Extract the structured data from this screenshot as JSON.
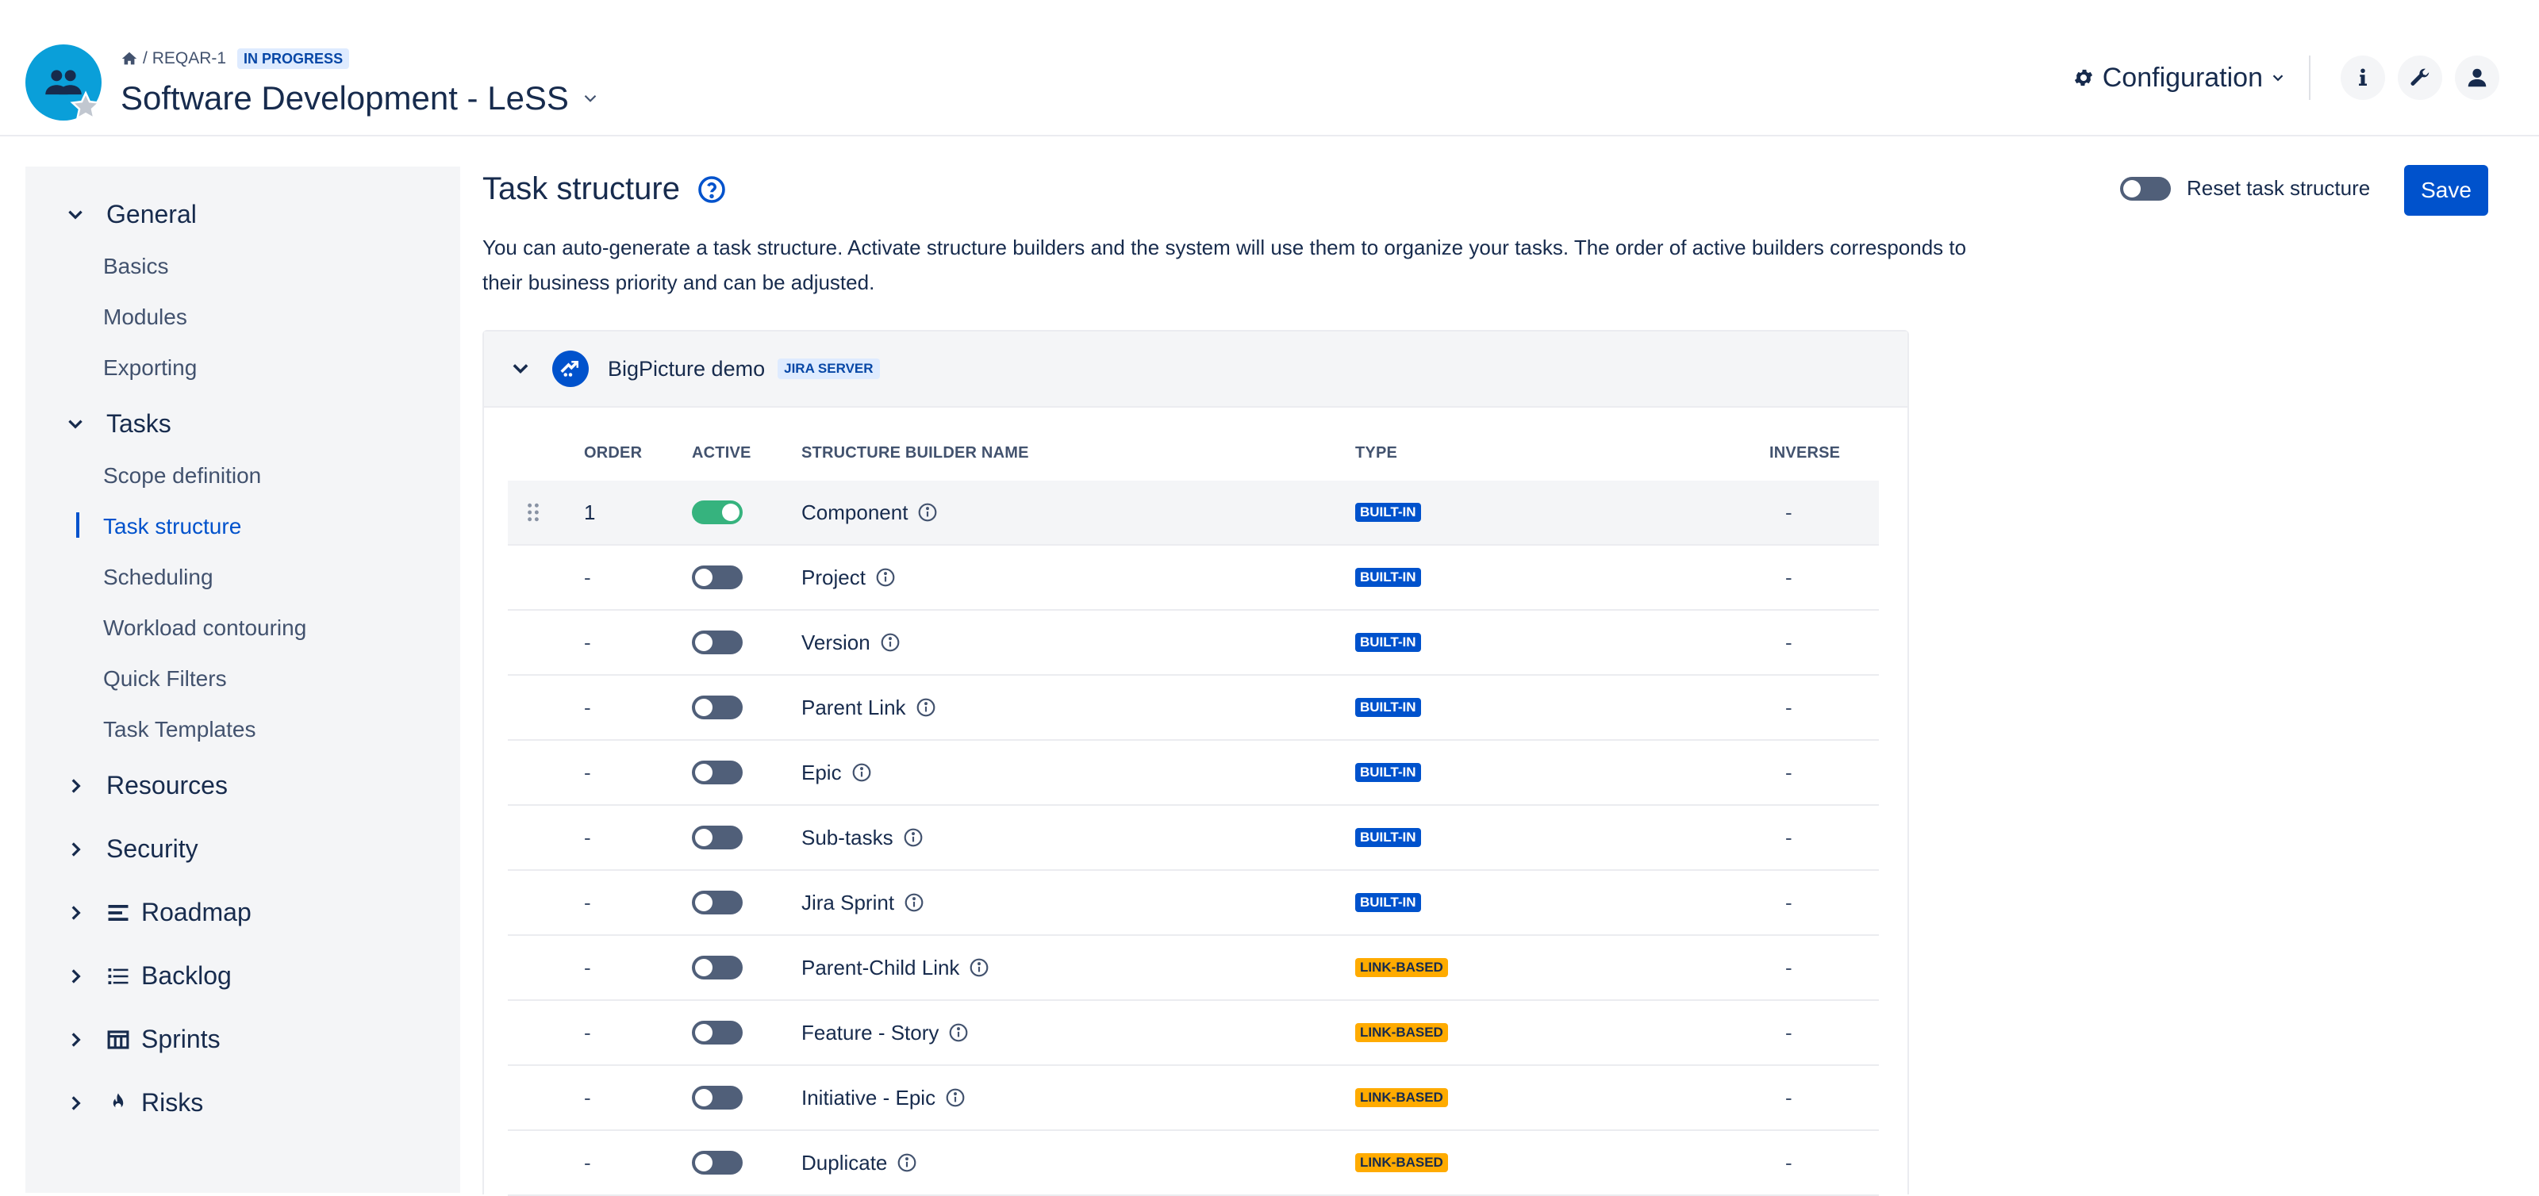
{
  "header": {
    "breadcrumb_key": "REQAR-1",
    "breadcrumb_sep": "/",
    "status": "IN PROGRESS",
    "project_title": "Software Development - LeSS",
    "config_label": "Configuration"
  },
  "sidebar": {
    "groups": [
      {
        "label": "General",
        "expanded": true,
        "items": [
          "Basics",
          "Modules",
          "Exporting"
        ]
      },
      {
        "label": "Tasks",
        "expanded": true,
        "items": [
          "Scope definition",
          "Task structure",
          "Scheduling",
          "Workload contouring",
          "Quick Filters",
          "Task Templates"
        ],
        "active": "Task structure"
      },
      {
        "label": "Resources",
        "expanded": false
      },
      {
        "label": "Security",
        "expanded": false
      },
      {
        "label": "Roadmap",
        "expanded": false,
        "icon": "roadmap-icon"
      },
      {
        "label": "Backlog",
        "expanded": false,
        "icon": "list-icon"
      },
      {
        "label": "Sprints",
        "expanded": false,
        "icon": "board-icon"
      },
      {
        "label": "Risks",
        "expanded": false,
        "icon": "fire-icon"
      }
    ]
  },
  "main": {
    "title": "Task structure",
    "description": "You can auto-generate a task structure. Activate structure builders and the system will use them to organize your tasks. The order of active builders corresponds to their business priority and can be adjusted.",
    "reset_label": "Reset task structure",
    "save_label": "Save",
    "instance": {
      "name": "BigPicture demo",
      "badge": "JIRA SERVER"
    },
    "columns": [
      "ORDER",
      "ACTIVE",
      "STRUCTURE BUILDER NAME",
      "TYPE",
      "INVERSE"
    ],
    "rows": [
      {
        "order": "1",
        "active": true,
        "name": "Component",
        "type": "BUILT-IN",
        "inverse": "-"
      },
      {
        "order": "-",
        "active": false,
        "name": "Project",
        "type": "BUILT-IN",
        "inverse": "-"
      },
      {
        "order": "-",
        "active": false,
        "name": "Version",
        "type": "BUILT-IN",
        "inverse": "-"
      },
      {
        "order": "-",
        "active": false,
        "name": "Parent Link",
        "type": "BUILT-IN",
        "inverse": "-"
      },
      {
        "order": "-",
        "active": false,
        "name": "Epic",
        "type": "BUILT-IN",
        "inverse": "-"
      },
      {
        "order": "-",
        "active": false,
        "name": "Sub-tasks",
        "type": "BUILT-IN",
        "inverse": "-"
      },
      {
        "order": "-",
        "active": false,
        "name": "Jira Sprint",
        "type": "BUILT-IN",
        "inverse": "-"
      },
      {
        "order": "-",
        "active": false,
        "name": "Parent-Child Link",
        "type": "LINK-BASED",
        "inverse": "-"
      },
      {
        "order": "-",
        "active": false,
        "name": "Feature - Story",
        "type": "LINK-BASED",
        "inverse": "-"
      },
      {
        "order": "-",
        "active": false,
        "name": "Initiative - Epic",
        "type": "LINK-BASED",
        "inverse": "-"
      },
      {
        "order": "-",
        "active": false,
        "name": "Duplicate",
        "type": "LINK-BASED",
        "inverse": "-"
      }
    ]
  },
  "colors": {
    "accent": "#0052cc",
    "toggle_on": "#36b37e",
    "built_in": "#0052cc",
    "link_based": "#ffab00"
  }
}
